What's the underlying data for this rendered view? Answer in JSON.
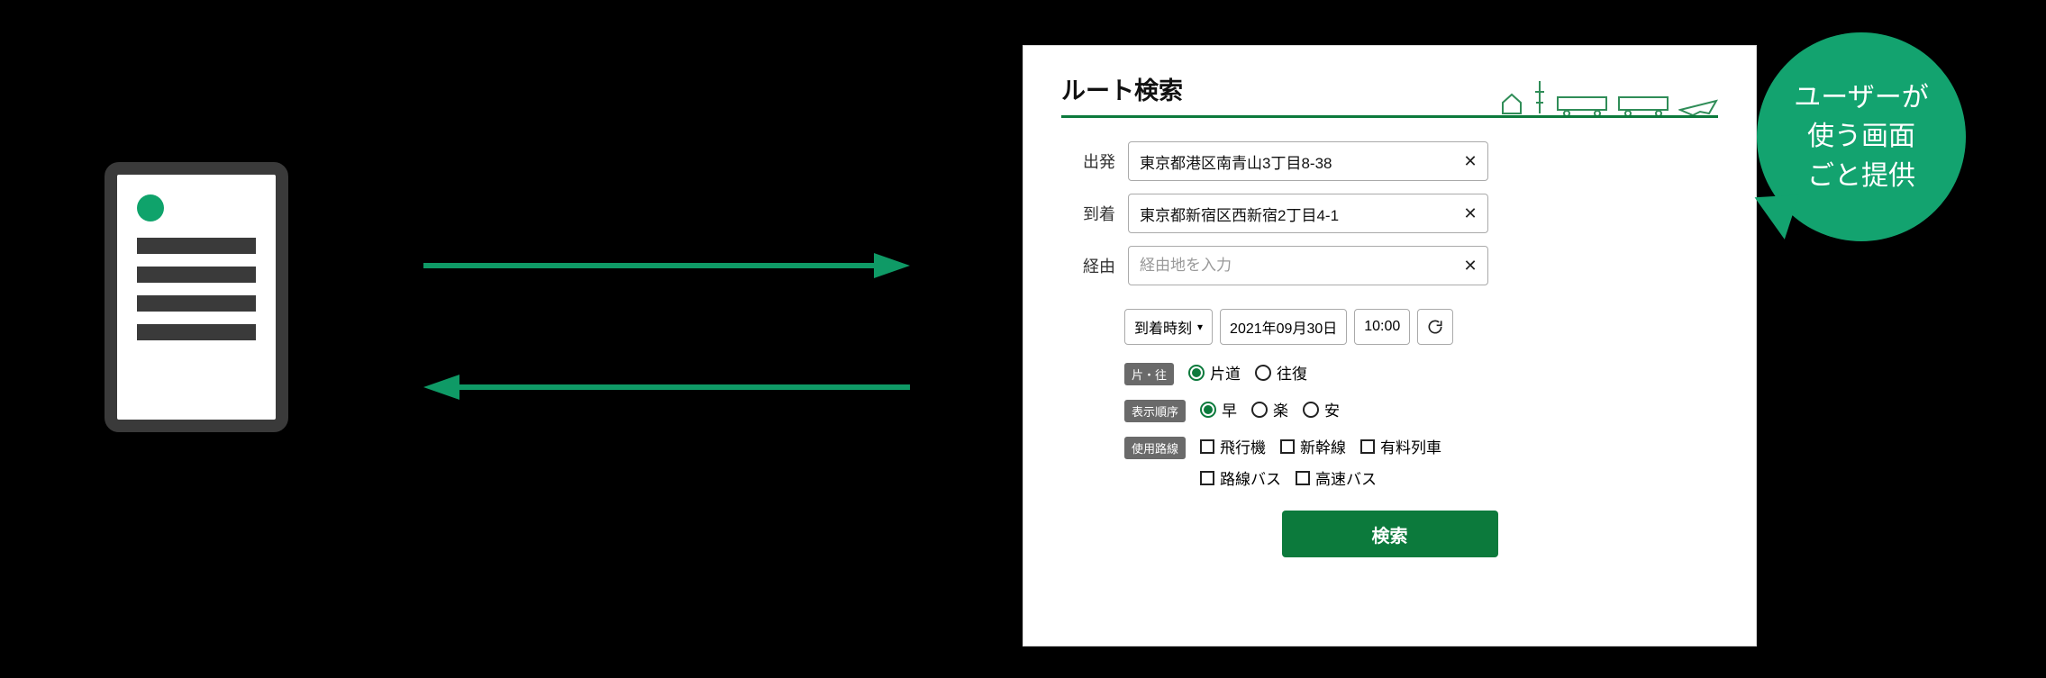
{
  "callout_text": "ユーザーが\n使う画面\nごと提供",
  "panel": {
    "title": "ルート検索",
    "fields": {
      "departure": {
        "label": "出発",
        "value": "東京都港区南青山3丁目8-38"
      },
      "arrival": {
        "label": "到着",
        "value": "東京都新宿区西新宿2丁目4-1"
      },
      "via": {
        "label": "経由",
        "placeholder": "経由地を入力"
      }
    },
    "time_mode": {
      "selected": "到着時刻"
    },
    "date_value": "2021年09月30日",
    "time_value": "10:00",
    "trip_type": {
      "pill": "片・往",
      "options": [
        "片道",
        "往復"
      ],
      "selected": "片道"
    },
    "sort_order": {
      "pill": "表示順序",
      "options": [
        "早",
        "楽",
        "安"
      ],
      "selected": "早"
    },
    "transport": {
      "pill": "使用路線",
      "options_line1": [
        "飛行機",
        "新幹線",
        "有料列車"
      ],
      "options_line2": [
        "路線バス",
        "高速バス"
      ]
    },
    "search_button": "検索"
  }
}
